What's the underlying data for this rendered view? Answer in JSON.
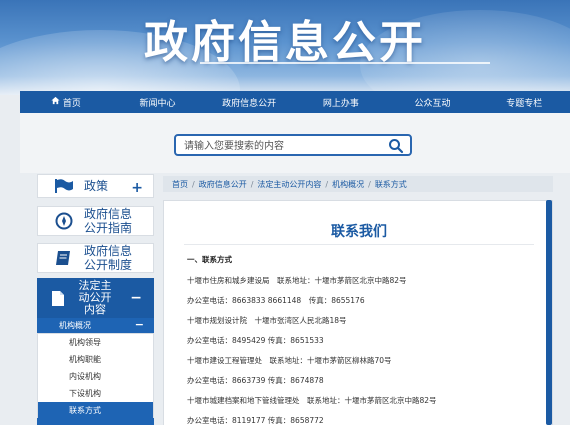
{
  "banner": {
    "title": "政府信息公开"
  },
  "nav": {
    "items": [
      {
        "label": "首页",
        "icon": "home-icon"
      },
      {
        "label": "新闻中心"
      },
      {
        "label": "政府信息公开"
      },
      {
        "label": "网上办事"
      },
      {
        "label": "公众互动"
      },
      {
        "label": "专题专栏"
      }
    ]
  },
  "search": {
    "placeholder": "请输入您要搜索的内容",
    "icon": "search-icon"
  },
  "sidebar": {
    "policy": {
      "label": "政策",
      "icon": "flag-icon"
    },
    "guide": {
      "line1": "政府信息",
      "line2": "公开指南",
      "icon": "compass-icon"
    },
    "system": {
      "line1": "政府信息",
      "line2": "公开制度",
      "icon": "book-icon"
    },
    "statutory": {
      "line1": "法定主",
      "line2": "动公开",
      "line3": "内容",
      "icon": "document-icon"
    },
    "sub_head": "机构概况",
    "sub_items": [
      "机构领导",
      "机构职能",
      "内设机构",
      "下设机构",
      "联系方式"
    ],
    "active_sub": "联系方式"
  },
  "breadcrumb": [
    "首页",
    "政府信息公开",
    "法定主动公开内容",
    "机构概况",
    "联系方式"
  ],
  "content": {
    "title": "联系我们",
    "section": "一、联系方式",
    "lines": [
      "十堰市住房和城乡建设局　联系地址：十堰市茅箭区北京中路82号",
      "办公室电话：8663833  8661148　传真：8655176",
      "十堰市规划设计院　十堰市张湾区人民北路18号",
      "办公室电话：8495429  传真：8651533",
      "十堰市建设工程管理处　联系地址：十堰市茅箭区柳林路70号",
      "办公室电话：8663739  传真：8674878",
      "十堰市城建档案和地下管线管理处　联系地址：十堰市茅箭区北京中路82号",
      "办公室电话：8119177  传真：8658772"
    ]
  },
  "colors": {
    "primary": "#1b5aa3",
    "title": "#1b5aa3",
    "active": "#1e64b4"
  }
}
